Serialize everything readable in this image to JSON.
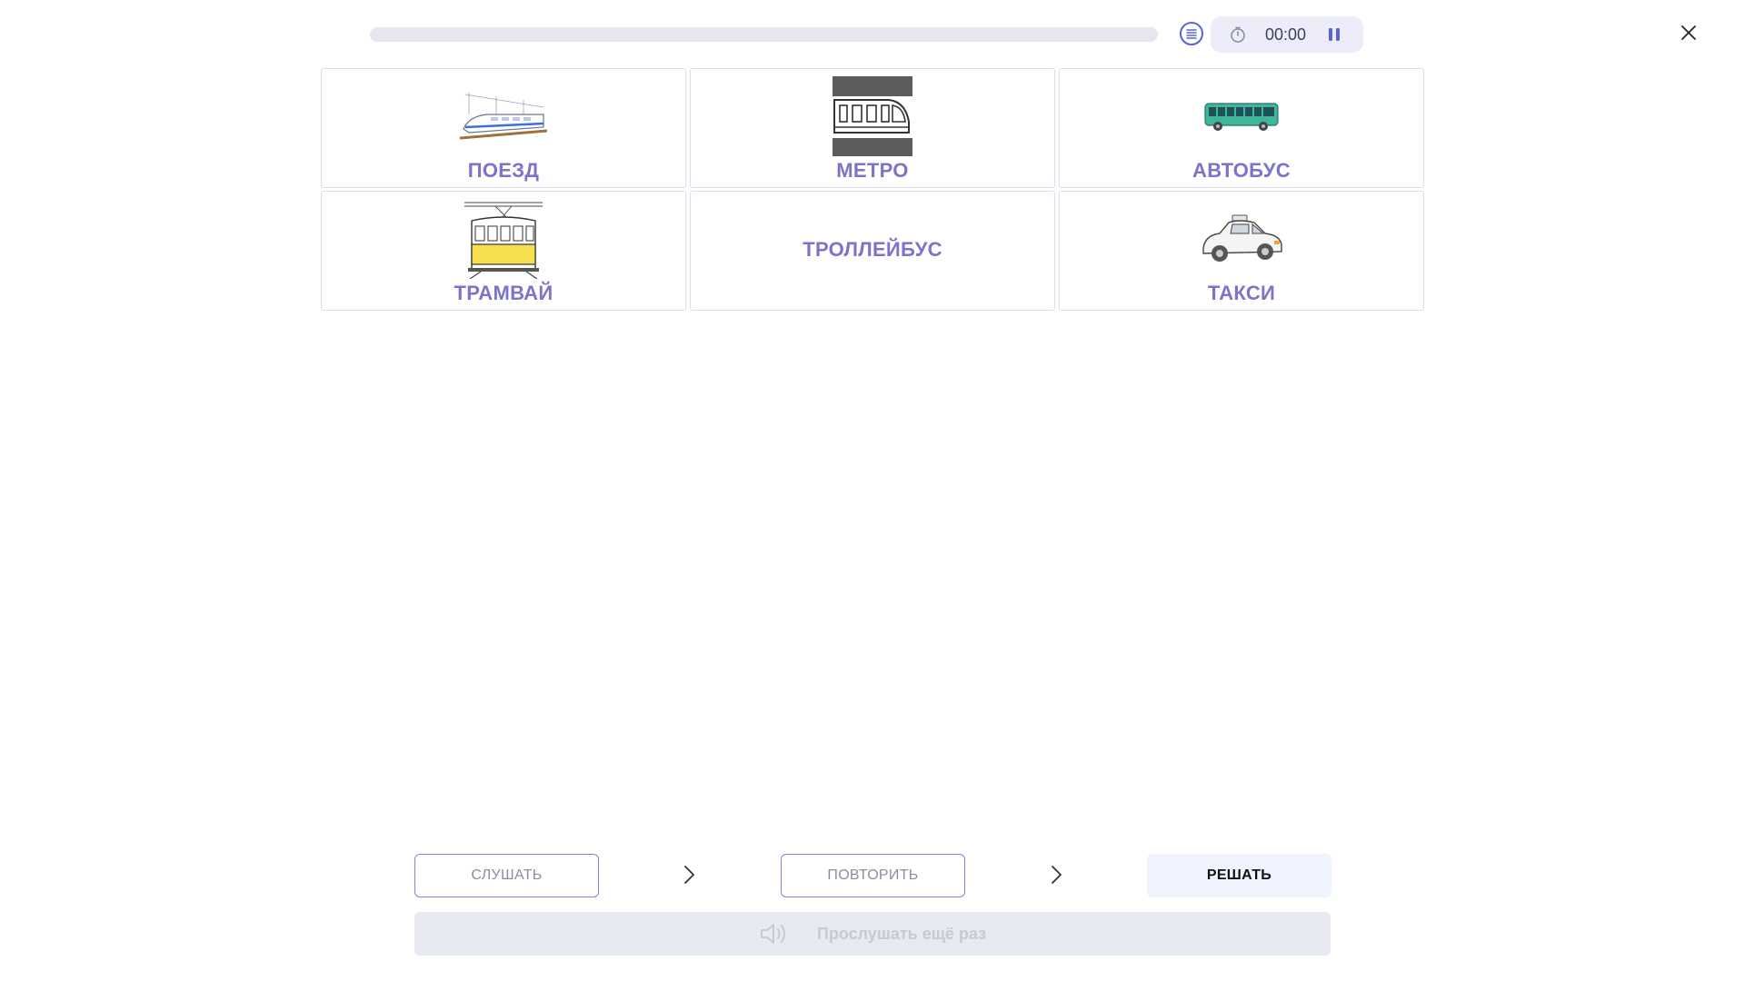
{
  "progress": {
    "fraction": 0.0
  },
  "timer": {
    "time": "00:00"
  },
  "icons": {
    "list": "list-icon",
    "clock": "stopwatch-icon",
    "pause": "pause-icon",
    "close": "close-icon",
    "chevron": "chevron-right-icon",
    "speaker": "speaker-icon"
  },
  "cards": [
    {
      "label": "ПОЕЗД"
    },
    {
      "label": "МЕТРО"
    },
    {
      "label": "АВТОБУС"
    },
    {
      "label": "ТРАМВАЙ"
    },
    {
      "label": "ТРОЛЛЕЙБУС"
    },
    {
      "label": "ТАКСИ"
    }
  ],
  "steps": {
    "listen": "СЛУШАТЬ",
    "repeat": "ПОВТОРИТЬ",
    "solve": "РЕШАТЬ"
  },
  "replay": {
    "label": "Прослушать ещё раз"
  },
  "colors": {
    "accent": "#5b64d6",
    "card_label": "#7b74c8",
    "outline": "#8b7fe0"
  }
}
